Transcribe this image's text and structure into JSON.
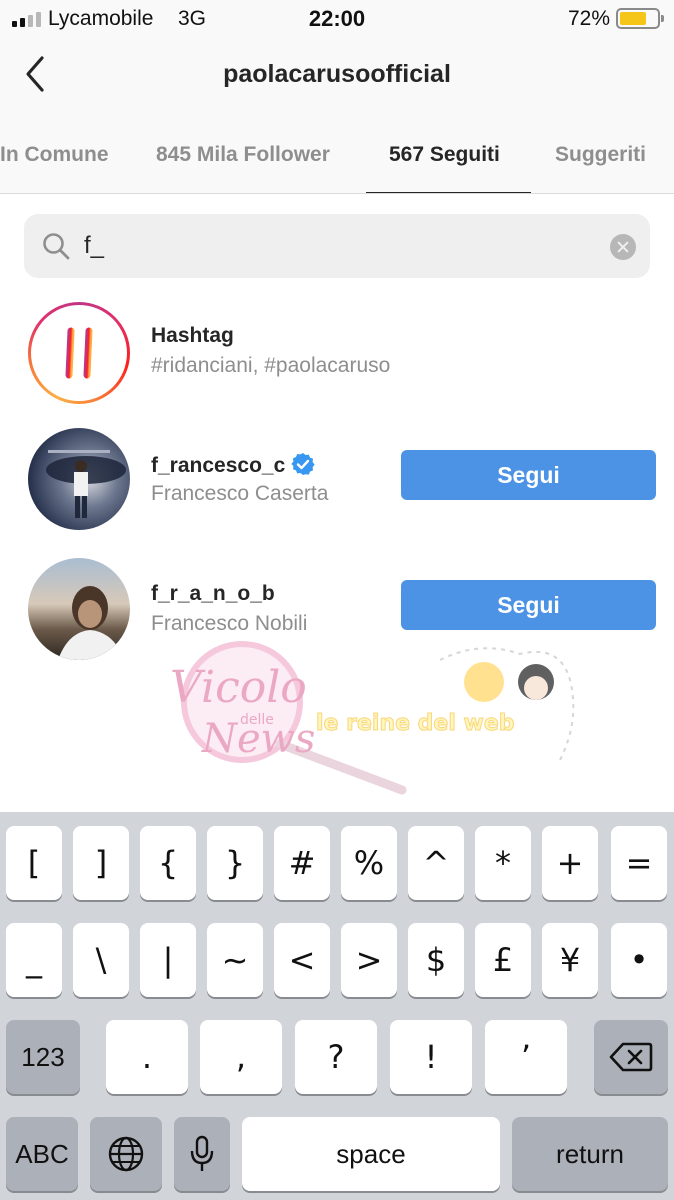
{
  "status_bar": {
    "carrier": "Lycamobile",
    "network": "3G",
    "time": "22:00",
    "battery": "72%",
    "battery_color": "#f5c518"
  },
  "header": {
    "title": "paolacarusoofficial",
    "back_icon": "chevron-left-icon"
  },
  "tabs": [
    {
      "label": "In Comune",
      "active": false
    },
    {
      "label": "845 Mila Follower",
      "active": false
    },
    {
      "label": "567 Seguiti",
      "active": true
    },
    {
      "label": "Suggeriti",
      "active": false
    }
  ],
  "search": {
    "value": "f_",
    "icon": "search-icon",
    "clear_icon": "clear-icon"
  },
  "results": [
    {
      "type": "hashtag",
      "title": "Hashtag",
      "subtitle": "#ridanciani, #paolacaruso"
    },
    {
      "type": "user",
      "username": "f_rancesco_c",
      "verified": true,
      "full_name": "Francesco Caserta",
      "button": "Segui"
    },
    {
      "type": "user",
      "username": "f_r_a_n_o_b",
      "verified": false,
      "full_name": "Francesco Nobili",
      "button": "Segui"
    }
  ],
  "watermark": {
    "text_main": "Vicolo",
    "text_small": "delle",
    "text_news": "News",
    "tagline": "le reine del web"
  },
  "keyboard": {
    "row1": [
      "[",
      "]",
      "{",
      "}",
      "#",
      "%",
      "^",
      "*",
      "+",
      "="
    ],
    "row2": [
      "_",
      "\\",
      "|",
      "~",
      "<",
      ">",
      "$",
      "£",
      "¥",
      "•"
    ],
    "row3": [
      "123",
      ".",
      ",",
      "?",
      "!",
      "’"
    ],
    "row4": {
      "abc": "ABC",
      "space": "space",
      "return": "return"
    },
    "accent": "#4c93e6"
  }
}
